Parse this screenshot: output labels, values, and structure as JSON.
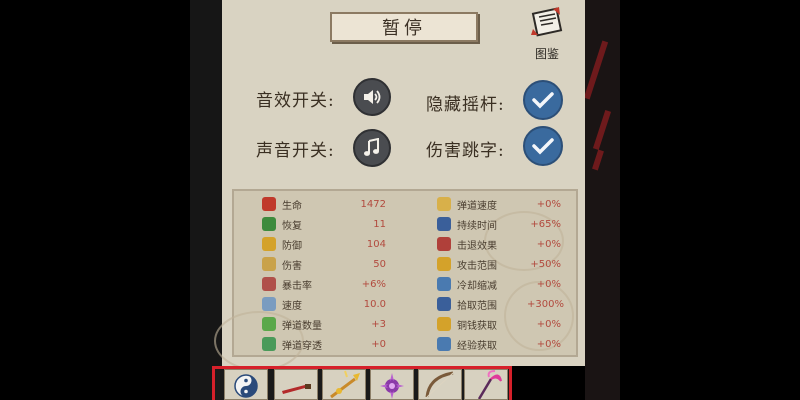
{
  "header": {
    "title": "暂停",
    "codex_label": "图鉴"
  },
  "options": {
    "sound_effects": {
      "label": "音效开关:",
      "icon": "speaker-icon",
      "on": true
    },
    "sound": {
      "label": "声音开关:",
      "icon": "music-note-icon",
      "on": true
    },
    "hide_joystick": {
      "label": "隐藏摇杆:",
      "icon": "checkmark-icon",
      "checked": true
    },
    "damage_numbers": {
      "label": "伤害跳字:",
      "icon": "checkmark-icon",
      "checked": true
    }
  },
  "stats_left": [
    {
      "name": "生命",
      "value": "1472",
      "icon": "heart-icon",
      "color": "#c0392b"
    },
    {
      "name": "恢复",
      "value": "11",
      "icon": "regen-icon",
      "color": "#3d8b3d"
    },
    {
      "name": "防御",
      "value": "104",
      "icon": "shield-icon",
      "color": "#d4a22a"
    },
    {
      "name": "伤害",
      "value": "50",
      "icon": "sword-icon",
      "color": "#c9a24a"
    },
    {
      "name": "暴击率",
      "value": "+6%",
      "icon": "crit-icon",
      "color": "#b0504a"
    },
    {
      "name": "速度",
      "value": "10.0",
      "icon": "boot-icon",
      "color": "#7a9cc0"
    },
    {
      "name": "弹道数量",
      "value": "+3",
      "icon": "multishot-icon",
      "color": "#5aa84a"
    },
    {
      "name": "弹道穿透",
      "value": "+0",
      "icon": "pierce-icon",
      "color": "#4a9a5a"
    }
  ],
  "stats_right": [
    {
      "name": "弹道速度",
      "value": "+0%",
      "icon": "wing-icon",
      "color": "#d8b04a"
    },
    {
      "name": "持续时间",
      "value": "+65%",
      "icon": "hourglass-icon",
      "color": "#3a5f9a"
    },
    {
      "name": "击退效果",
      "value": "+0%",
      "icon": "fist-icon",
      "color": "#b0403a"
    },
    {
      "name": "攻击范围",
      "value": "+50%",
      "icon": "area-icon",
      "color": "#d4a22a"
    },
    {
      "name": "冷却缩减",
      "value": "+0%",
      "icon": "cooldown-icon",
      "color": "#4a7ab0"
    },
    {
      "name": "拾取范围",
      "value": "+300%",
      "icon": "magnet-icon",
      "color": "#3a5f9a"
    },
    {
      "name": "铜钱获取",
      "value": "+0%",
      "icon": "coin-icon",
      "color": "#d4a22a"
    },
    {
      "name": "经验获取",
      "value": "+0%",
      "icon": "book-icon",
      "color": "#4a7ab0"
    }
  ],
  "equipment_slots": [
    {
      "icon": "yin-yang-icon"
    },
    {
      "icon": "red-blade-icon"
    },
    {
      "icon": "golden-spear-icon"
    },
    {
      "icon": "purple-crystal-icon"
    },
    {
      "icon": "bow-icon"
    },
    {
      "icon": "pink-scythe-icon"
    }
  ]
}
